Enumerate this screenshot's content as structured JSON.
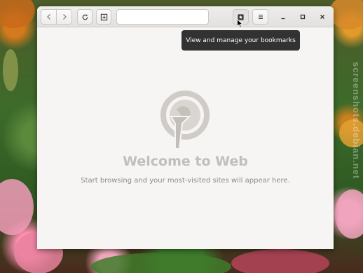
{
  "window": {
    "url_value": "",
    "tooltip": "View and manage your bookmarks"
  },
  "welcome": {
    "title": "Welcome to Web",
    "subtitle": "Start browsing and your most-visited sites will appear here."
  },
  "desktop": {
    "watermark": "screenshots.debian.net"
  },
  "icons": {
    "back": "chevron-left-icon",
    "forward": "chevron-right-icon",
    "reload": "reload-icon",
    "new_tab": "new-tab-icon",
    "bookmarks": "bookmarks-icon",
    "menu": "hamburger-menu-icon",
    "minimize": "minimize-icon",
    "maximize": "maximize-icon",
    "close": "close-icon",
    "logo": "epiphany-web-logo"
  },
  "colors": {
    "window_bg": "#f6f5f4",
    "headerbar": "#e8e6e3",
    "tooltip_bg": "#212121",
    "welcome_title": "#c2bebb",
    "welcome_subtitle": "#8f8b88"
  }
}
